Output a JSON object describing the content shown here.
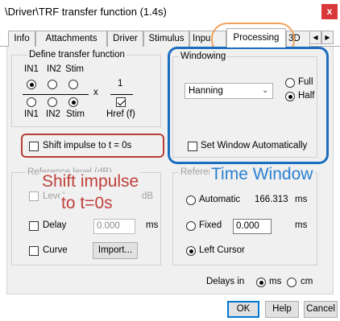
{
  "window": {
    "title": "\\Driver\\TRF transfer function (1.4s)",
    "close_glyph": "x"
  },
  "tabs": [
    {
      "label": "Info"
    },
    {
      "label": "Attachments"
    },
    {
      "label": "Driver"
    },
    {
      "label": "Stimulus"
    },
    {
      "label": "Inpu"
    },
    {
      "label": "Processing",
      "active": true
    },
    {
      "label": "3D"
    }
  ],
  "tab_scroll": {
    "left": "◀",
    "right": "▶"
  },
  "define_tf": {
    "legend": "Define transfer function",
    "top_labels": [
      "IN1",
      "IN2",
      "Stim"
    ],
    "bottom_labels": [
      "IN1",
      "IN2",
      "Stim"
    ],
    "times": "x",
    "one": "1",
    "href_label": "Href (f)",
    "href_checked": true,
    "top_selected": 0,
    "bottom_selected": 2
  },
  "shift_impulse": {
    "label": "Shift impulse to t = 0s",
    "checked": false
  },
  "windowing": {
    "legend": "Windowing",
    "type": "Hanning",
    "options": [
      "Full",
      "Half"
    ],
    "selected": "Half",
    "auto_label": "Set Window Automatically",
    "auto_checked": false
  },
  "reference_left": {
    "legend": "Reference level (dB)",
    "level_label": "Level",
    "level_unit": "dB",
    "delay_label": "Delay",
    "delay_value": "0.000",
    "delay_unit": "ms",
    "curve_label": "Curve",
    "import_label": "Import..."
  },
  "reference_right": {
    "legend": "Reference delay",
    "automatic_label": "Automatic",
    "automatic_value": "166.313",
    "automatic_unit": "ms",
    "fixed_label": "Fixed",
    "fixed_value": "0.000",
    "fixed_unit": "ms",
    "left_cursor_label": "Left Cursor",
    "selected": "Left Cursor"
  },
  "delays_in": {
    "label": "Delays in",
    "options": [
      "ms",
      "cm"
    ],
    "selected": "ms"
  },
  "buttons": {
    "ok": "OK",
    "help": "Help",
    "cancel": "Cancel"
  },
  "annotations": {
    "shift_text_line1": "Shift impulse",
    "shift_text_line2": "to t=0s",
    "time_window_text": "Time Window",
    "colors": {
      "orange": "#f2a25e",
      "red": "#b93d35",
      "blue": "#1a6dbf"
    }
  }
}
